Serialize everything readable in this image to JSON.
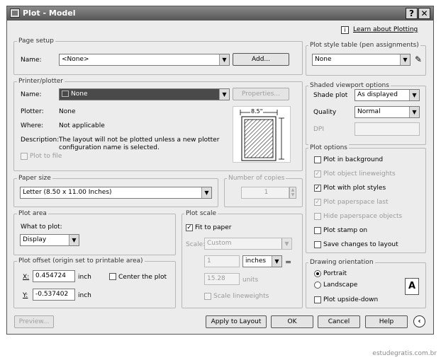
{
  "window": {
    "title": "Plot - Model",
    "help_glyph": "?",
    "close_glyph": "✕"
  },
  "learn": {
    "info_glyph": "i",
    "link": "Learn about Plotting"
  },
  "page_setup": {
    "legend": "Page setup",
    "name_label": "Name:",
    "name_value": "<None>",
    "add_button": "Add..."
  },
  "printer": {
    "legend": "Printer/plotter",
    "name_label": "Name:",
    "name_value": "None",
    "properties_button": "Properties...",
    "plotter_label": "Plotter:",
    "plotter_value": "None",
    "where_label": "Where:",
    "where_value": "Not applicable",
    "description_label": "Description:",
    "description_line1": "The layout will not be plotted unless a new plotter",
    "description_line2": "configuration name is selected.",
    "plot_to_file": "Plot to file",
    "preview_dimension": "8.5\""
  },
  "plot_style": {
    "legend": "Plot style table (pen assignments)",
    "value": "None"
  },
  "shaded": {
    "legend": "Shaded viewport options",
    "shade_plot_label": "Shade plot",
    "shade_plot_value": "As displayed",
    "quality_label": "Quality",
    "quality_value": "Normal",
    "dpi_label": "DPI"
  },
  "paper_size": {
    "legend": "Paper size",
    "value": "Letter (8.50 x 11.00 Inches)"
  },
  "copies": {
    "legend": "Number of copies",
    "value": "1"
  },
  "plot_area": {
    "legend": "Plot area",
    "what_label": "What to plot:",
    "what_value": "Display"
  },
  "plot_offset": {
    "legend": "Plot offset (origin set to printable area)",
    "x_label": "X:",
    "x_value": "0.454724",
    "x_unit": "inch",
    "y_label": "Y:",
    "y_value": "-0.537402",
    "y_unit": "inch",
    "center": "Center the plot"
  },
  "plot_scale": {
    "legend": "Plot scale",
    "fit": "Fit to paper",
    "scale_label": "Scale:",
    "scale_value": "Custom",
    "value1": "1",
    "unit1": "inches",
    "equals": "=",
    "value2": "15.28",
    "unit2": "units",
    "lineweights": "Scale lineweights"
  },
  "plot_options": {
    "legend": "Plot options",
    "items": [
      {
        "label": "Plot in background",
        "checked": false,
        "enabled": true
      },
      {
        "label": "Plot object lineweights",
        "checked": true,
        "enabled": false
      },
      {
        "label": "Plot with plot styles",
        "checked": true,
        "enabled": true
      },
      {
        "label": "Plot paperspace last",
        "checked": true,
        "enabled": false
      },
      {
        "label": "Hide paperspace objects",
        "checked": false,
        "enabled": false
      },
      {
        "label": "Plot stamp on",
        "checked": false,
        "enabled": true
      },
      {
        "label": "Save changes to layout",
        "checked": false,
        "enabled": true
      }
    ]
  },
  "orientation": {
    "legend": "Drawing orientation",
    "portrait": "Portrait",
    "landscape": "Landscape",
    "upside_down": "Plot upside-down",
    "icon_letter": "A"
  },
  "footer": {
    "preview": "Preview...",
    "apply": "Apply to Layout",
    "ok": "OK",
    "cancel": "Cancel",
    "help": "Help"
  },
  "watermark": "estudegratis.com.br"
}
